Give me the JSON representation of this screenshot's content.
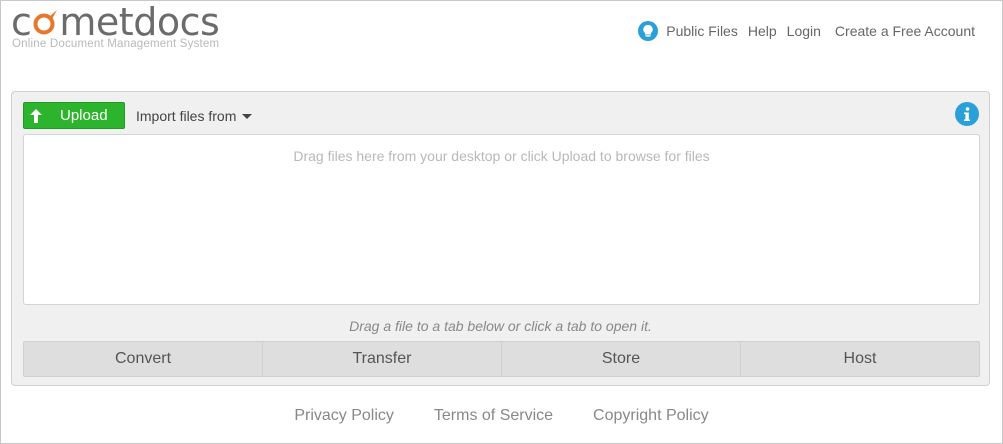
{
  "logo": {
    "prefix": "c",
    "suffix": "metdocs",
    "tagline": "Online Document Management System",
    "accent_color": "#e8772e"
  },
  "topnav": {
    "public_files": "Public Files",
    "help": "Help",
    "login": "Login",
    "create_account": "Create a Free Account",
    "public_files_icon": "lightbulb-icon"
  },
  "toolbar": {
    "upload_label": "Upload",
    "upload_icon": "arrow-up-icon",
    "import_label": "Import files from",
    "info_icon": "info-icon"
  },
  "dropzone": {
    "hint": "Drag files here from your desktop or click Upload to browse for files"
  },
  "tabs": {
    "hint": "Drag a file to a tab below or click a tab to open it.",
    "items": [
      {
        "label": "Convert"
      },
      {
        "label": "Transfer"
      },
      {
        "label": "Store"
      },
      {
        "label": "Host"
      }
    ]
  },
  "footer": {
    "links": [
      {
        "label": "Privacy Policy"
      },
      {
        "label": "Terms of Service"
      },
      {
        "label": "Copyright Policy"
      }
    ]
  },
  "colors": {
    "upload_green": "#2cb52c",
    "info_blue": "#2a9fd8"
  }
}
